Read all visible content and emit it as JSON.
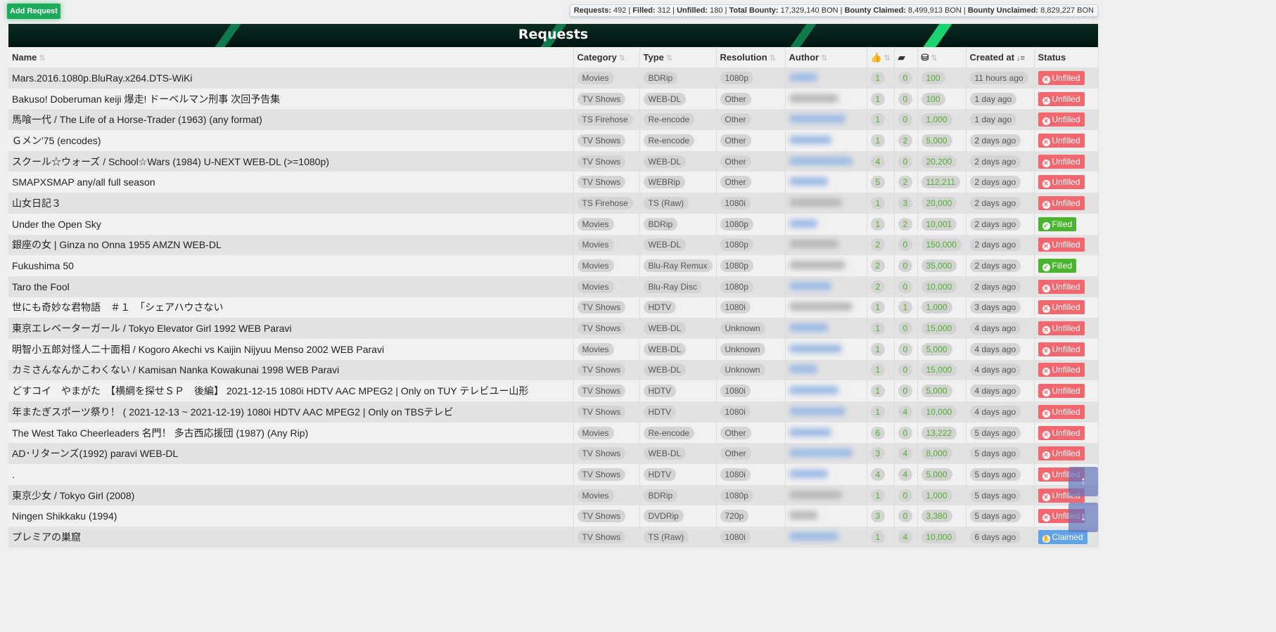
{
  "toolbar": {
    "add_request": "Add Request"
  },
  "stats": {
    "requests_label": "Requests:",
    "requests": "492",
    "filled_label": "Filled:",
    "filled": "312",
    "unfilled_label": "Unfilled:",
    "unfilled": "180",
    "total_label": "Total Bounty:",
    "total": "17,329,140 BON",
    "claimed_label": "Bounty Claimed:",
    "claimed": "8,499,913 BON",
    "unclaimed_label": "Bounty Unclaimed:",
    "unclaimed": "8,829,227 BON"
  },
  "banner": {
    "title": "Requests"
  },
  "columns": {
    "name": "Name",
    "category": "Category",
    "type": "Type",
    "resolution": "Resolution",
    "author": "Author",
    "votes": "thumbs-up-icon",
    "comments": "comment-icon",
    "bounty": "coins-icon",
    "created": "Created at",
    "status": "Status"
  },
  "colors": {
    "unfilled": "#f4676f",
    "filled": "#49b52e",
    "claimed": "#5fa2e6",
    "bounty_text": "#4caf2a",
    "add_button": "#1cab5a"
  },
  "rows": [
    {
      "name": "Mars.2016.1080p.BluRay.x264.DTS-WiKi",
      "category": "Movies",
      "type": "BDRip",
      "resolution": "1080p",
      "author_link": true,
      "votes": "1",
      "comments": "0",
      "bounty": "100",
      "created": "11 hours ago",
      "status": "Unfilled"
    },
    {
      "name": "Bakuso! Doberuman keiji 爆走! ドーベルマン刑事 次回予告集",
      "category": "TV Shows",
      "type": "WEB-DL",
      "resolution": "Other",
      "author_link": false,
      "votes": "1",
      "comments": "0",
      "bounty": "100",
      "created": "1 day ago",
      "status": "Unfilled"
    },
    {
      "name": "馬喰一代 / The Life of a Horse-Trader (1963) (any format)",
      "category": "TS Firehose",
      "type": "Re-encode",
      "resolution": "Other",
      "author_link": true,
      "votes": "1",
      "comments": "0",
      "bounty": "1,000",
      "created": "1 day ago",
      "status": "Unfilled"
    },
    {
      "name": "Ｇメン'75 (encodes)",
      "category": "TV Shows",
      "type": "Re-encode",
      "resolution": "Other",
      "author_link": true,
      "votes": "1",
      "comments": "2",
      "bounty": "5,000",
      "created": "2 days ago",
      "status": "Unfilled"
    },
    {
      "name": "スクール☆ウォーズ / School☆Wars (1984) U-NEXT WEB-DL (>=1080p)",
      "category": "TV Shows",
      "type": "WEB-DL",
      "resolution": "Other",
      "author_link": true,
      "votes": "4",
      "comments": "0",
      "bounty": "20,200",
      "created": "2 days ago",
      "status": "Unfilled"
    },
    {
      "name": "SMAPXSMAP any/all full season",
      "category": "TV Shows",
      "type": "WEBRip",
      "resolution": "Other",
      "author_link": true,
      "votes": "5",
      "comments": "2",
      "bounty": "112,211",
      "created": "2 days ago",
      "status": "Unfilled"
    },
    {
      "name": "山女日記３",
      "category": "TS Firehose",
      "type": "TS (Raw)",
      "resolution": "1080i",
      "author_link": false,
      "votes": "1",
      "comments": "3",
      "bounty": "20,000",
      "created": "2 days ago",
      "status": "Unfilled"
    },
    {
      "name": "Under the Open Sky",
      "category": "Movies",
      "type": "BDRip",
      "resolution": "1080p",
      "author_link": true,
      "votes": "1",
      "comments": "2",
      "bounty": "10,001",
      "created": "2 days ago",
      "status": "Filled"
    },
    {
      "name": "銀座の女 | Ginza no Onna 1955 AMZN WEB-DL",
      "category": "Movies",
      "type": "WEB-DL",
      "resolution": "1080p",
      "author_link": false,
      "votes": "2",
      "comments": "0",
      "bounty": "150,000",
      "created": "2 days ago",
      "status": "Unfilled"
    },
    {
      "name": "Fukushima 50",
      "category": "Movies",
      "type": "Blu-Ray Remux",
      "resolution": "1080p",
      "author_link": false,
      "votes": "2",
      "comments": "0",
      "bounty": "35,000",
      "created": "2 days ago",
      "status": "Filled"
    },
    {
      "name": "Taro the Fool",
      "category": "Movies",
      "type": "Blu-Ray Disc",
      "resolution": "1080p",
      "author_link": true,
      "votes": "2",
      "comments": "0",
      "bounty": "10,000",
      "created": "2 days ago",
      "status": "Unfilled"
    },
    {
      "name": "世にも奇妙な君物語　＃１　「シェアハウさない",
      "category": "TV Shows",
      "type": "HDTV",
      "resolution": "1080i",
      "author_link": false,
      "votes": "1",
      "comments": "1",
      "bounty": "1,000",
      "created": "3 days ago",
      "status": "Unfilled"
    },
    {
      "name": "東京エレベーターガール / Tokyo Elevator Girl 1992 WEB Paravi",
      "category": "TV Shows",
      "type": "WEB-DL",
      "resolution": "Unknown",
      "author_link": true,
      "votes": "1",
      "comments": "0",
      "bounty": "15,000",
      "created": "4 days ago",
      "status": "Unfilled"
    },
    {
      "name": "明智小五郎対怪人二十面相 / Kogoro Akechi vs Kaijin Nijyuu Menso 2002 WEB Paravi",
      "category": "Movies",
      "type": "WEB-DL",
      "resolution": "Unknown",
      "author_link": true,
      "votes": "1",
      "comments": "0",
      "bounty": "5,000",
      "created": "4 days ago",
      "status": "Unfilled"
    },
    {
      "name": "カミさんなんかこわくない / Kamisan Nanka Kowakunai 1998 WEB Paravi",
      "category": "TV Shows",
      "type": "WEB-DL",
      "resolution": "Unknown",
      "author_link": true,
      "votes": "1",
      "comments": "0",
      "bounty": "15,000",
      "created": "4 days ago",
      "status": "Unfilled"
    },
    {
      "name": "どすコイ　やまがた　【横綱を探せＳＰ　後編】 2021-12-15 1080i HDTV AAC MPEG2 | Only on TUY テレビユー山形",
      "category": "TV Shows",
      "type": "HDTV",
      "resolution": "1080i",
      "author_link": true,
      "votes": "1",
      "comments": "0",
      "bounty": "5,000",
      "created": "4 days ago",
      "status": "Unfilled"
    },
    {
      "name": "年またぎスポーツ祭り！ ( 2021-12-13 ~ 2021-12-19) 1080i HDTV AAC MPEG2 | Only on TBSテレビ",
      "category": "TV Shows",
      "type": "HDTV",
      "resolution": "1080i",
      "author_link": true,
      "votes": "1",
      "comments": "4",
      "bounty": "10,000",
      "created": "4 days ago",
      "status": "Unfilled"
    },
    {
      "name": "The West Tako Cheerleaders 名門！ 多古西応援団 (1987) (Any Rip)",
      "category": "Movies",
      "type": "Re-encode",
      "resolution": "Other",
      "author_link": true,
      "votes": "6",
      "comments": "0",
      "bounty": "13,222",
      "created": "5 days ago",
      "status": "Unfilled"
    },
    {
      "name": "AD･リターンズ(1992) paravi WEB-DL",
      "category": "TV Shows",
      "type": "WEB-DL",
      "resolution": "Other",
      "author_link": true,
      "votes": "3",
      "comments": "4",
      "bounty": "8,000",
      "created": "5 days ago",
      "status": "Unfilled"
    },
    {
      "name": ".",
      "category": "TV Shows",
      "type": "HDTV",
      "resolution": "1080i",
      "author_link": true,
      "votes": "4",
      "comments": "4",
      "bounty": "5,000",
      "created": "5 days ago",
      "status": "Unfilled"
    },
    {
      "name": "東京少女 / Tokyo Girl (2008)",
      "category": "Movies",
      "type": "BDRip",
      "resolution": "1080p",
      "author_link": false,
      "votes": "1",
      "comments": "0",
      "bounty": "1,000",
      "created": "5 days ago",
      "status": "Unfilled"
    },
    {
      "name": "Ningen Shikkaku (1994)",
      "category": "TV Shows",
      "type": "DVDRip",
      "resolution": "720p",
      "author_link": false,
      "votes": "3",
      "comments": "0",
      "bounty": "3,380",
      "created": "5 days ago",
      "status": "Unfilled"
    },
    {
      "name": "プレミアの巣窟",
      "category": "TV Shows",
      "type": "TS (Raw)",
      "resolution": "1080i",
      "author_link": true,
      "votes": "1",
      "comments": "4",
      "bounty": "10,000",
      "created": "6 days ago",
      "status": "Claimed"
    }
  ]
}
